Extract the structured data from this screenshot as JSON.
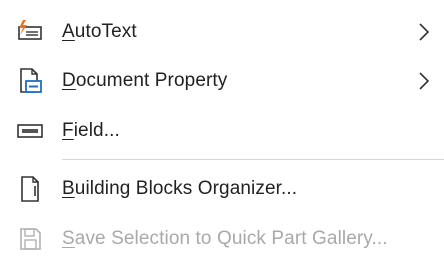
{
  "menu": {
    "items": [
      {
        "mnemonic": "A",
        "rest": "utoText",
        "icon": "autotext-icon",
        "has_submenu": true,
        "enabled": true
      },
      {
        "mnemonic": "D",
        "rest": "ocument Property",
        "icon": "document-property-icon",
        "has_submenu": true,
        "enabled": true
      },
      {
        "mnemonic": "F",
        "rest": "ield...",
        "icon": "field-icon",
        "has_submenu": false,
        "enabled": true
      },
      {
        "mnemonic": "B",
        "rest": "uilding Blocks Organizer...",
        "icon": "building-blocks-icon",
        "has_submenu": false,
        "enabled": true
      },
      {
        "mnemonic": "S",
        "rest": "ave Selection to Quick Part Gallery...",
        "icon": "save-selection-icon",
        "has_submenu": false,
        "enabled": false
      }
    ]
  },
  "colors": {
    "text": "#222222",
    "disabled_text": "#a9a9a9",
    "accent_orange": "#e8731c",
    "accent_blue": "#1e6fc8",
    "divider": "#d6d6d6"
  }
}
